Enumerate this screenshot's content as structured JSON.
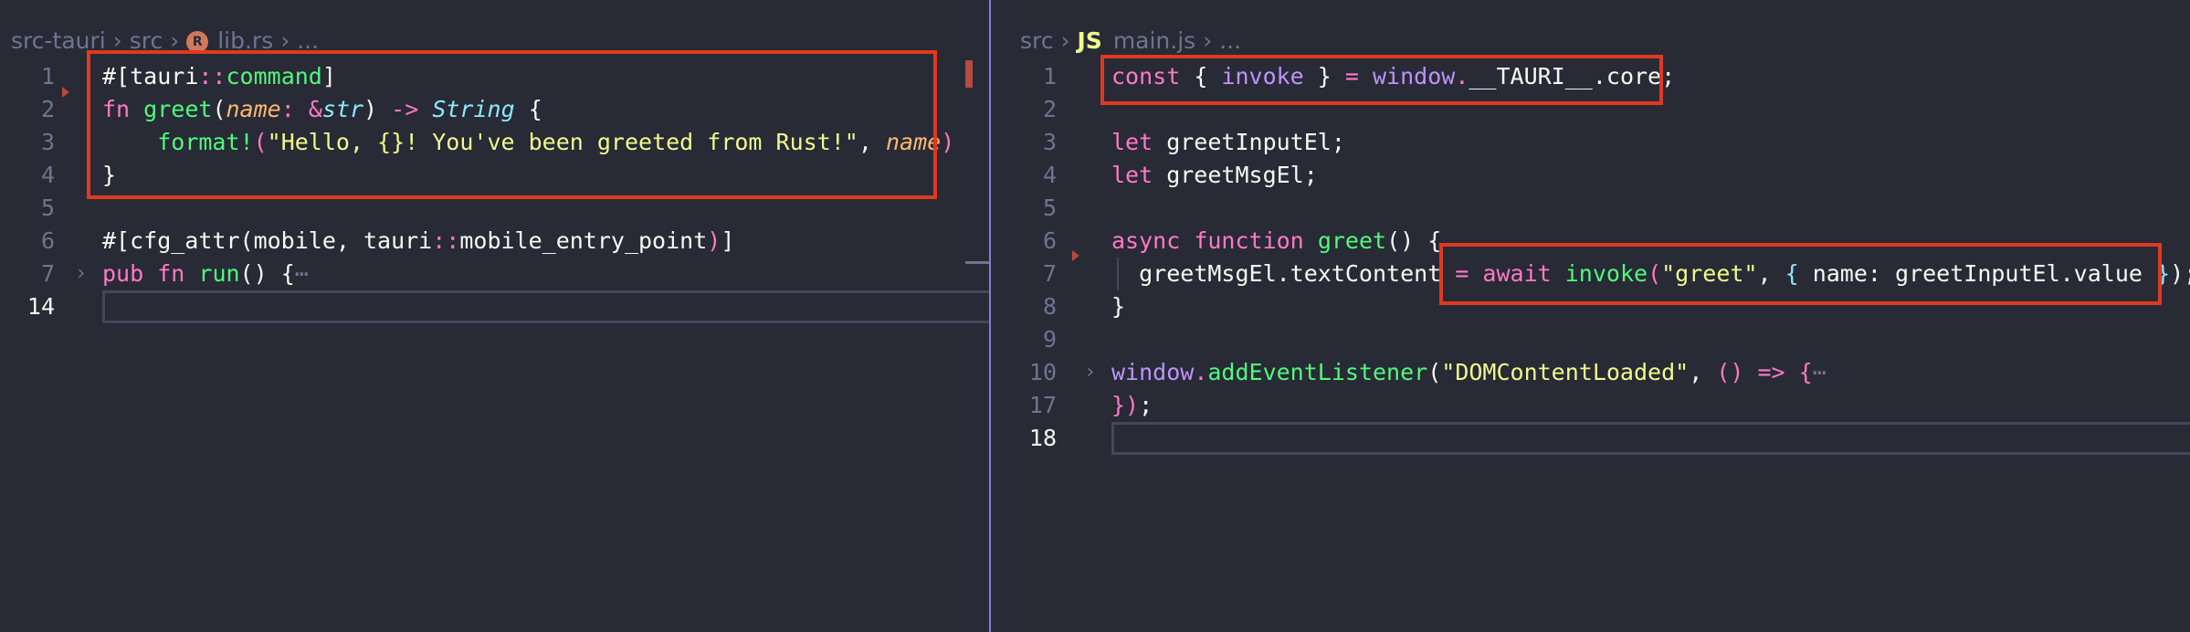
{
  "left_editor": {
    "breadcrumb": [
      "src-tauri",
      "src",
      "lib.rs",
      "..."
    ],
    "lines": [
      {
        "num": "1"
      },
      {
        "num": "2"
      },
      {
        "num": "3"
      },
      {
        "num": "4"
      },
      {
        "num": "5"
      },
      {
        "num": "6"
      },
      {
        "num": "7"
      },
      {
        "num": "14"
      }
    ],
    "code": {
      "l1": {
        "a": "#[",
        "b": "tauri",
        "c": "::",
        "d": "command",
        "e": "]"
      },
      "l2": {
        "a": "fn",
        "b": "greet",
        "c": "(",
        "d": "name",
        "e": ": ",
        "f": "&",
        "g": "str",
        "h": ") ",
        "i": "->",
        "j": "String",
        "k": " {"
      },
      "l3": {
        "a": "format!",
        "b": "(",
        "c": "\"Hello, {}! You've been greeted from Rust!\"",
        "d": ", ",
        "e": "name",
        "f": ")"
      },
      "l4": {
        "a": "}"
      },
      "l6": {
        "a": "#[cfg_attr(mobile, tauri",
        "b": "::",
        "c": "mobile_entry_point",
        "d": ")",
        "e": "]"
      },
      "l7": {
        "a": "pub",
        "b": "fn",
        "c": "run",
        "d": "() {",
        "e": "⋯"
      }
    }
  },
  "right_editor": {
    "breadcrumb": [
      "src",
      "JS",
      "main.js",
      "..."
    ],
    "lines": [
      {
        "num": "1"
      },
      {
        "num": "2"
      },
      {
        "num": "3"
      },
      {
        "num": "4"
      },
      {
        "num": "5"
      },
      {
        "num": "6"
      },
      {
        "num": "7"
      },
      {
        "num": "8"
      },
      {
        "num": "9"
      },
      {
        "num": "10"
      },
      {
        "num": "17"
      },
      {
        "num": "18"
      }
    ],
    "code": {
      "l1": {
        "a": "const",
        "b": " { ",
        "c": "invoke",
        "d": " } ",
        "e": "=",
        "f": " window",
        "g": ".",
        "h": "__TAURI__",
        "i": ".core;"
      },
      "l3": {
        "a": "let",
        "b": " greetInputEl;"
      },
      "l4": {
        "a": "let",
        "b": " greetMsgEl;"
      },
      "l6": {
        "a": "async",
        "b": "function",
        "c": "greet",
        "d": "() {"
      },
      "l7": {
        "a": "greetMsgEl.textContent ",
        "b": "=",
        "c": "await",
        "d": "invoke",
        "e": "(",
        "f": "\"greet\"",
        "g": ", ",
        "h": "{",
        "i": " name: greetInputEl.value ",
        "j": "}",
        "k": ");"
      },
      "l8": {
        "a": "}"
      },
      "l10": {
        "a": "window",
        "b": ".",
        "c": "addEventListener",
        "d": "(",
        "e": "\"DOMContentLoaded\"",
        "f": ", ",
        "g": "()",
        "h": " => ",
        "i": "{",
        "j": "⋯"
      },
      "l17": {
        "a": "})",
        "b": ";"
      }
    }
  },
  "icons": {
    "fold_collapsed": "›",
    "rust_file": "rust-file-icon",
    "js_file": "js-file-icon"
  },
  "colors": {
    "background": "#282a36",
    "highlight_box": "#e0391f",
    "keyword": "#ff79c6",
    "function": "#50fa7b",
    "string": "#f1fa8c",
    "parameter": "#ffb86c",
    "type": "#8be9fd",
    "constant": "#bd93f9"
  }
}
